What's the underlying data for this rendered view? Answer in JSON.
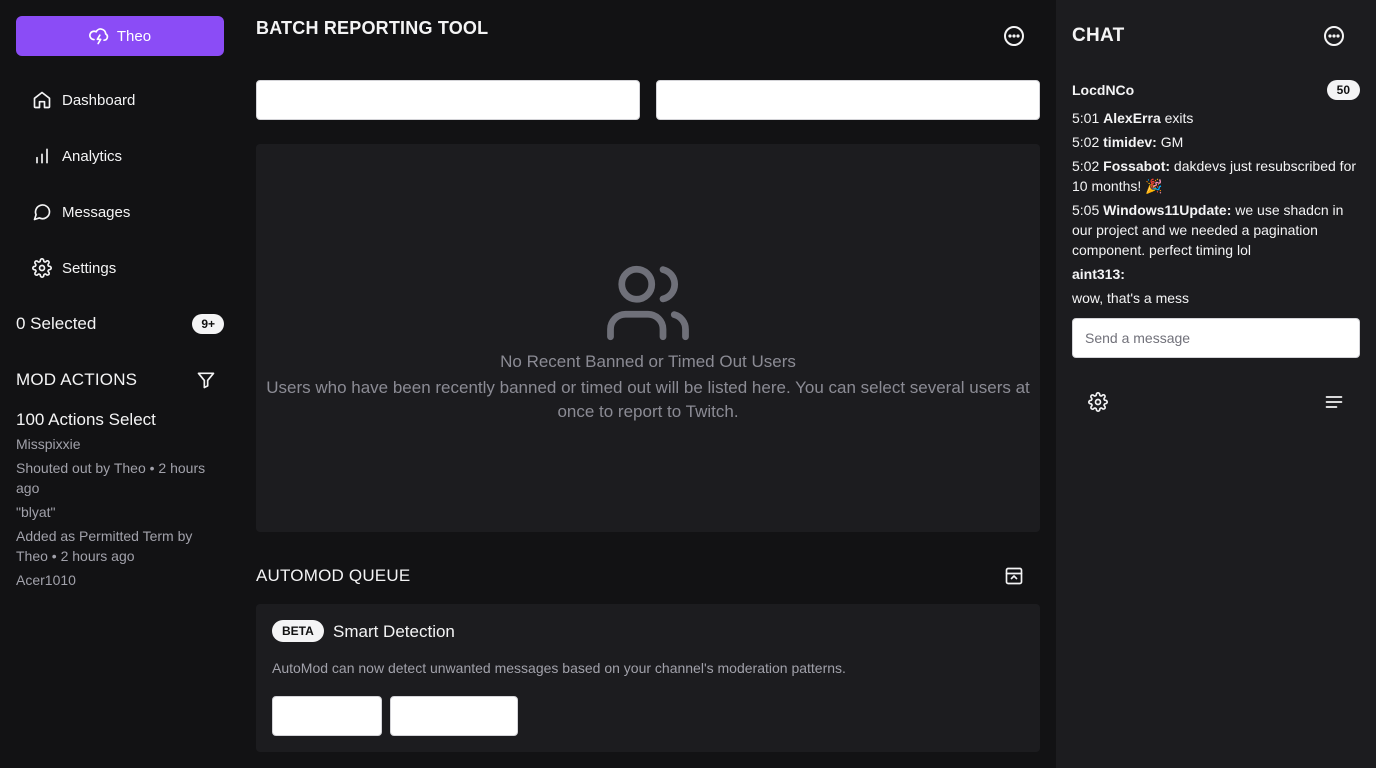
{
  "sidebar": {
    "user_button": {
      "label": "Theo",
      "icon": "cloud-lightning-icon"
    },
    "nav": [
      {
        "label": "Dashboard",
        "icon": "home-icon"
      },
      {
        "label": "Analytics",
        "icon": "bar-chart-icon"
      },
      {
        "label": "Messages",
        "icon": "message-circle-icon"
      },
      {
        "label": "Settings",
        "icon": "gear-icon"
      }
    ],
    "selected": {
      "label": "0 Selected",
      "badge": "9+"
    },
    "mod_actions": {
      "heading": "MOD ACTIONS",
      "filter_icon": "filter-icon",
      "title": "100 Actions Select",
      "lines": [
        "Misspixxie",
        "Shouted out by Theo • 2 hours ago",
        "\"blyat\"",
        "Added as Permitted Term by Theo • 2 hours ago",
        "Acer1010"
      ]
    }
  },
  "main": {
    "title": "BATCH REPORTING TOOL",
    "empty": {
      "icon": "users-icon",
      "title": "No Recent Banned or Timed Out Users",
      "description": "Users who have been recently banned or timed out will be listed here. You can select several users at once to report to Twitch."
    },
    "automod": {
      "heading": "AUTOMOD QUEUE",
      "icon": "archive-icon",
      "beta": "BETA",
      "card_title": "Smart Detection",
      "card_desc": "AutoMod can now detect unwanted messages based on your channel's moderation patterns."
    }
  },
  "chat": {
    "title": "CHAT",
    "user": "LocdNCo",
    "count": "50",
    "messages": [
      {
        "time": "5:01",
        "user": "AlexErra",
        "text": "exits"
      },
      {
        "time": "5:02",
        "user": "timidev:",
        "text": "GM"
      },
      {
        "time": "5:02",
        "user": "Fossabot:",
        "text": "dakdevs just resubscribed for 10 months! 🎉"
      },
      {
        "time": "5:05",
        "user": "Windows11Update:",
        "text": "we use shadcn in our project and we needed a pagination component. perfect timing lol"
      },
      {
        "time": "",
        "user": "aint313:",
        "text": ""
      },
      {
        "time": "",
        "user": "",
        "text": "wow, that's a mess"
      }
    ],
    "input_placeholder": "Send a message"
  },
  "colors": {
    "accent": "#8b4cf6",
    "background": "#121214",
    "panel": "#1c1c1f"
  }
}
